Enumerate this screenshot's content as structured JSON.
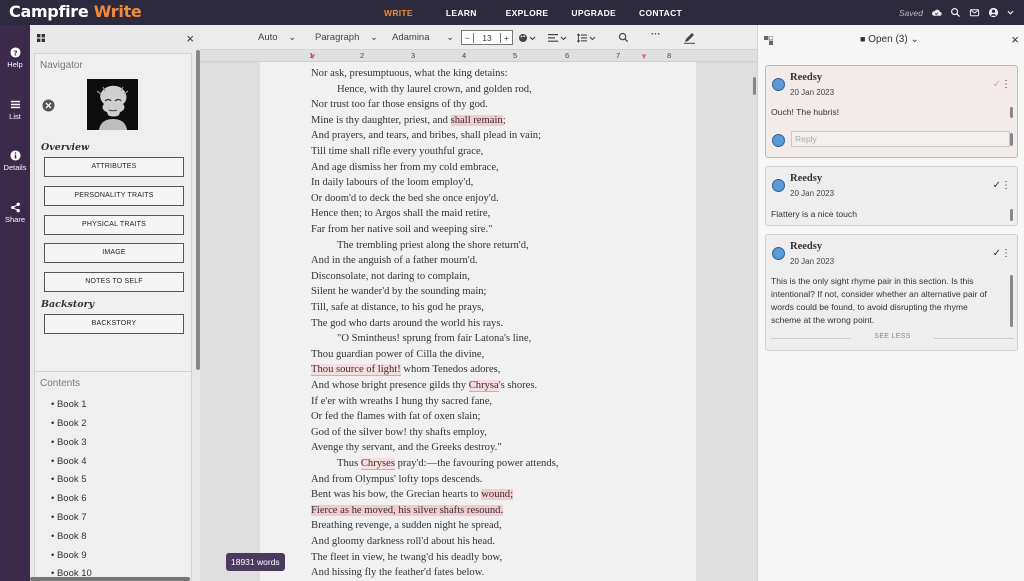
{
  "app": {
    "logo_main": "Campfire ",
    "logo_accent": "Write",
    "nav": [
      "WRITE",
      "LEARN",
      "EXPLORE",
      "UPGRADE",
      "CONTACT"
    ],
    "saved": "Saved"
  },
  "rail": [
    {
      "label": "Help",
      "icon": "help-icon"
    },
    {
      "label": "List",
      "icon": "list-icon"
    },
    {
      "label": "Details",
      "icon": "info-icon"
    },
    {
      "label": "Share",
      "icon": "share-icon"
    }
  ],
  "sidebar": {
    "navigator_title": "Navigator",
    "overview_heading": "Overview",
    "overview_buttons": [
      "ATTRIBUTES",
      "PERSONALITY TRAITS",
      "PHYSICAL TRAITS",
      "IMAGE",
      "NOTES TO SELF"
    ],
    "backstory_heading": "Backstory",
    "backstory_buttons": [
      "BACKSTORY"
    ],
    "contents_title": "Contents",
    "books": [
      "Book 1",
      "Book 2",
      "Book 3",
      "Book 4",
      "Book 5",
      "Book 6",
      "Book 7",
      "Book 8",
      "Book 9",
      "Book 10"
    ]
  },
  "toolbar": {
    "auto": "Auto",
    "paragraph": "Paragraph",
    "font": "Adamina",
    "font_size": "13",
    "minus": "−",
    "plus": "+"
  },
  "ruler": [
    "1",
    "2",
    "3",
    "4",
    "5",
    "6",
    "7",
    "8"
  ],
  "document": {
    "word_count": "18931 words"
  },
  "comments": {
    "filter_label": "Open (3)",
    "items": [
      {
        "author": "Reedsy",
        "date": "20 Jan 2023",
        "text": [
          "Ouch! The hubris!"
        ],
        "reply_placeholder": "Reply"
      },
      {
        "author": "Reedsy",
        "date": "20 Jan 2023",
        "text": [
          "Flattery is a nice touch"
        ]
      },
      {
        "author": "Reedsy",
        "date": "20 Jan 2023",
        "text": [
          "This is the only sight rhyme pair in this section. Is this",
          "intentional? If not, consider whether an alternative pair of",
          "words could be found, to avoid disrupting the rhyme",
          "scheme at the wrong point."
        ],
        "see_less": "SEE LESS"
      }
    ]
  },
  "colors": {
    "topbar": "#2e2a3e",
    "accent": "#f28a3c",
    "rail": "#3b2a49",
    "highlight": "#f4c9cf"
  }
}
